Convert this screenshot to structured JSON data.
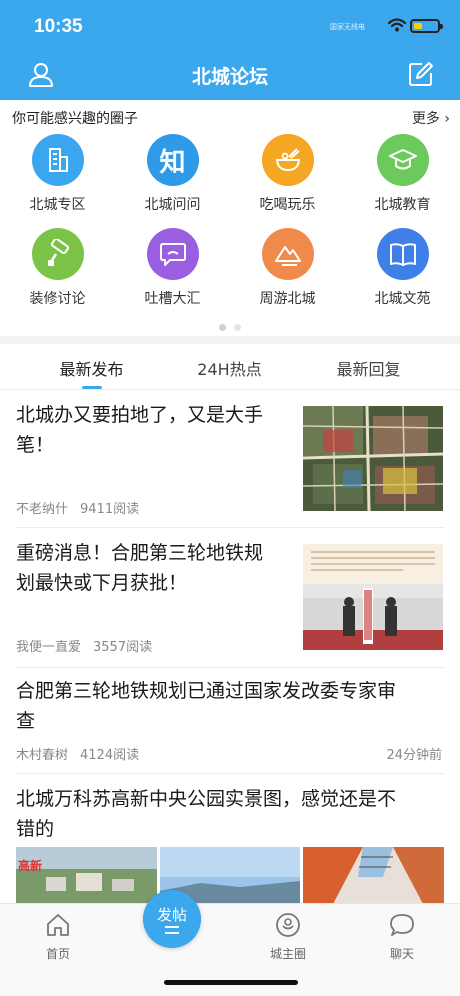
{
  "status_bar": {
    "time": "10:35",
    "carrier_text": "国家无线电"
  },
  "nav": {
    "title": "北城论坛"
  },
  "circles": {
    "title": "你可能感兴趣的圈子",
    "more": "更多",
    "items": [
      {
        "label": "北城专区",
        "icon": "building-icon",
        "color": "#3aa6f0"
      },
      {
        "label": "北城问问",
        "icon": "zhi-icon",
        "color": "#2f9be8"
      },
      {
        "label": "吃喝玩乐",
        "icon": "bowl-icon",
        "color": "#f5a623"
      },
      {
        "label": "北城教育",
        "icon": "graduation-cap-icon",
        "color": "#6cc95c"
      },
      {
        "label": "装修讨论",
        "icon": "paint-roller-icon",
        "color": "#7cc34a"
      },
      {
        "label": "吐槽大汇",
        "icon": "chat-bubble-icon",
        "color": "#9a5fe0"
      },
      {
        "label": "周游北城",
        "icon": "mountain-icon",
        "color": "#f08a4b"
      },
      {
        "label": "北城文苑",
        "icon": "book-icon",
        "color": "#3f7fe8"
      }
    ],
    "glyph": "知"
  },
  "tabs": [
    {
      "label": "最新发布",
      "active": true
    },
    {
      "label": "24H热点",
      "active": false
    },
    {
      "label": "最新回复",
      "active": false
    }
  ],
  "posts": [
    {
      "title_line1": "北城办又要拍地了，又是大手",
      "title_line2": "笔！",
      "author": "不老纳什",
      "reads": "9411阅读"
    },
    {
      "title_line1": "重磅消息！合肥第三轮地铁规",
      "title_line2": "划最快或下月获批！",
      "author": "我便一直爱",
      "reads": "3557阅读"
    },
    {
      "title_line1": "合肥第三轮地铁规划已通过国家发改委专家审",
      "title_line2": "查",
      "author": "木村春树",
      "reads": "4124阅读",
      "ago": "24分钟前"
    },
    {
      "title_line1": "北城万科苏高新中央公园实景图，感觉还是不",
      "title_line2": "错的"
    }
  ],
  "post_images": {
    "watermark": "高新"
  },
  "tabbar": {
    "home": "首页",
    "post": "发帖",
    "city_circle": "城主圈",
    "chat": "聊天"
  }
}
